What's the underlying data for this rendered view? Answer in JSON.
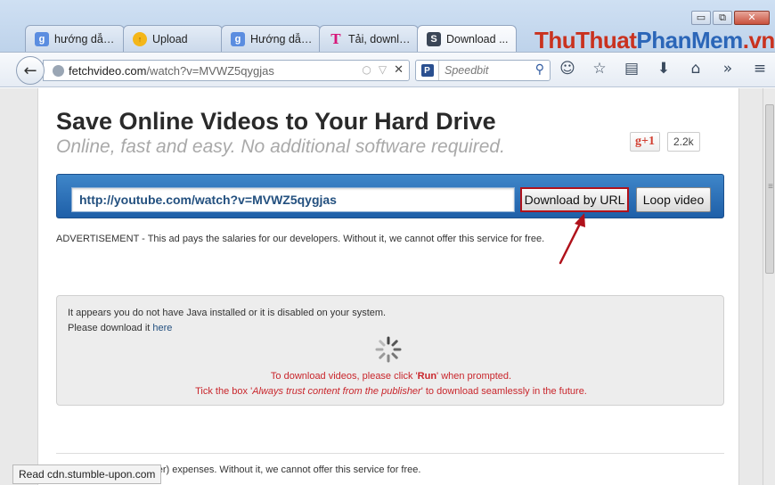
{
  "window": {
    "minimize": "▭",
    "restore": "⧉",
    "close": "✕"
  },
  "tabs": [
    {
      "label": "hướng dẫn ...",
      "icon": "google-icon",
      "icon_glyph": "g"
    },
    {
      "label": "Upload",
      "icon": "upload-icon",
      "icon_glyph": "↑"
    },
    {
      "label": "Hướng dẫn...",
      "icon": "google-icon",
      "icon_glyph": "g"
    },
    {
      "label": "Tải, downlo...",
      "icon": "t-icon",
      "icon_glyph": "T"
    },
    {
      "label": "Download ...",
      "icon": "s-icon",
      "icon_glyph": "S"
    }
  ],
  "watermark": {
    "part1": "ThuThuat",
    "part2": "PhanMem",
    "part3": ".vn"
  },
  "navbar": {
    "back_glyph": "←",
    "url_domain": "fetchvideo.com",
    "url_path": "/watch?v=MVWZ5qygjas",
    "search_placeholder": "Speedbit",
    "search_engine_glyph": "P",
    "search_glyph": "⚲",
    "toolbar_icons": [
      "☺",
      "☆",
      "▤",
      "⬇",
      "⌂",
      "»",
      "≡"
    ]
  },
  "page": {
    "headline": "Save Online Videos to Your Hard Drive",
    "tagline": "Online, fast and easy. No additional software required.",
    "gplus_label": "g+1",
    "gplus_count": "2.2k",
    "video_url": "http://youtube.com/watch?v=MVWZ5qygjas",
    "download_button": "Download by URL",
    "loop_button": "Loop video",
    "ad_note": "ADVERTISEMENT - This ad pays the salaries for our developers. Without it, we cannot offer this service for free.",
    "java": {
      "line1": "It appears you do not have Java installed or it is disabled on your system.",
      "line2_prefix": "Please download it ",
      "line2_link": "here",
      "run_prefix": "To download videos, please click '",
      "run_word": "Run",
      "run_suffix": "' when prompted.",
      "trust_prefix": "Tick the box '",
      "trust_italic": "Always trust content from the publisher",
      "trust_suffix": "' to download seamlessly in the future."
    },
    "bottom_note": "hosting (dedicated server) expenses. Without it, we cannot offer this service for free."
  },
  "statusbar": {
    "text": "Read cdn.stumble-upon.com"
  },
  "colors": {
    "accent_blue": "#1e5fa8",
    "highlight_red": "#b0121b",
    "warning_red": "#c9262c"
  }
}
